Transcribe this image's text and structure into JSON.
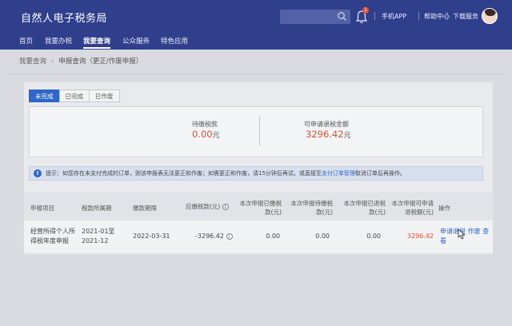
{
  "header": {
    "app_title": "自然人电子税务局",
    "notification_count": "1",
    "links": [
      "手机APP",
      "帮助中心",
      "下载服务"
    ]
  },
  "nav": {
    "items": [
      "首页",
      "我要办税",
      "我要查询",
      "公众服务",
      "特色应用"
    ],
    "active_index": 2
  },
  "breadcrumb": {
    "parent": "我要查询",
    "current": "申报查询（更正/作废申报）"
  },
  "tabs": [
    "未完成",
    "已完成",
    "已作废"
  ],
  "active_tab": 0,
  "summary": {
    "unpaid_label": "待缴税款",
    "unpaid_value": "0.00",
    "unpaid_unit": "元",
    "refund_label": "可申请退税金额",
    "refund_value": "3296.42",
    "refund_unit": "元"
  },
  "notice": {
    "text_before": "提示：如您存在未支付完成的订单，则该申报表无法更正和作废；如需更正和作废，请15分钟后再试，或直接至",
    "link": "支付订单管理",
    "text_after": "取消订单后再操作。"
  },
  "table": {
    "headers": {
      "item": "申报项目",
      "period": "税款所属期",
      "deadline": "缴款期限",
      "tax_due_line1": "应缴税款(元)",
      "declared_paid_line1": "本次申报已缴税",
      "declared_paid_line2": "款(元)",
      "declared_unpaid_line1": "本次申报待缴税",
      "declared_unpaid_line2": "款(元)",
      "declared_refunded_line1": "本次申报已退税",
      "declared_refunded_line2": "款(元)",
      "refundable_line1": "本次申报可申请",
      "refundable_line2": "退税额(元)",
      "ops": "操作"
    },
    "row": {
      "item_line1": "经营所得个人所",
      "item_line2": "得税年度申报",
      "period_line1": "2021-01至",
      "period_line2": "2021-12",
      "deadline": "2022-03-31",
      "tax_due": "-3296.42",
      "paid": "0.00",
      "unpaid": "0.00",
      "refunded": "0.00",
      "refundable": "3296.42",
      "op_refund": "申请退税",
      "op_void": "作废",
      "op_view_1": "查",
      "op_view_2": "看"
    }
  },
  "colors": {
    "header_bg": "#2f3f8c",
    "accent_blue": "#2f66c8",
    "value_red": "#e0512f"
  }
}
